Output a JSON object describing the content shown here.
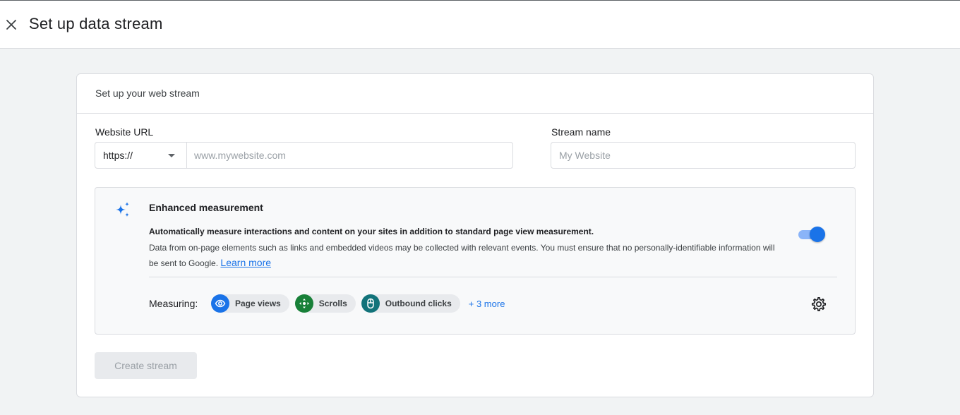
{
  "header": {
    "title": "Set up data stream",
    "close_icon": "close-icon"
  },
  "card": {
    "title": "Set up your web stream",
    "website_url": {
      "label": "Website URL",
      "protocol": "https://",
      "placeholder": "www.mywebsite.com",
      "value": ""
    },
    "stream_name": {
      "label": "Stream name",
      "placeholder": "My Website",
      "value": ""
    },
    "enhanced_measurement": {
      "icon": "sparkle-icon",
      "title": "Enhanced measurement",
      "description_primary": "Automatically measure interactions and content on your sites in addition to standard page view measurement.",
      "description_secondary": "Data from on-page elements such as links and embedded videos may be collected with relevant events. You must ensure that no personally-identifiable information will be sent to Google.",
      "learn_more": "Learn more",
      "enabled": true,
      "measuring_label": "Measuring:",
      "chips": [
        {
          "label": "Page views",
          "icon": "eye-icon",
          "color": "#1a73e8"
        },
        {
          "label": "Scrolls",
          "icon": "scroll-icon",
          "color": "#188038"
        },
        {
          "label": "Outbound clicks",
          "icon": "mouse-icon",
          "color": "#12737a"
        }
      ],
      "more": "+ 3 more",
      "settings_icon": "gear-icon"
    },
    "create_button": "Create stream"
  },
  "colors": {
    "accent": "#1a73e8",
    "toggle_track": "#8ab4f8",
    "background": "#f1f3f4"
  }
}
